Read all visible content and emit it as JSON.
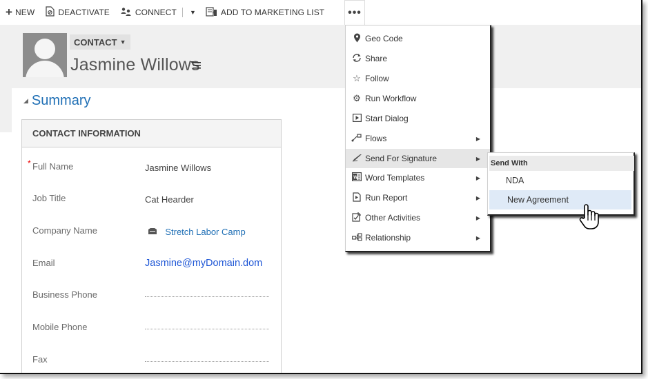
{
  "toolbar": {
    "new_label": "NEW",
    "deactivate_label": "DEACTIVATE",
    "connect_label": "CONNECT",
    "add_marketing_label": "ADD TO MARKETING LIST",
    "more_label": "•••"
  },
  "header": {
    "entity_label": "CONTACT",
    "record_name": "Jasmine Willows"
  },
  "summary": {
    "label": "Summary"
  },
  "contact_info": {
    "title": "CONTACT INFORMATION",
    "fields": [
      {
        "label": "Full Name",
        "value": "Jasmine Willows",
        "required": true
      },
      {
        "label": "Job Title",
        "value": "Cat Hearder"
      },
      {
        "label": "Company Name",
        "value": "Stretch Labor Camp"
      },
      {
        "label": "Email",
        "value": "Jasmine@myDomain.dom"
      },
      {
        "label": "Business Phone",
        "value": ""
      },
      {
        "label": "Mobile Phone",
        "value": ""
      },
      {
        "label": "Fax",
        "value": ""
      }
    ]
  },
  "more_menu": {
    "items": [
      {
        "label": "Geo Code",
        "icon": "map-pin-icon"
      },
      {
        "label": "Share",
        "icon": "share-icon"
      },
      {
        "label": "Follow",
        "icon": "star-icon"
      },
      {
        "label": "Run Workflow",
        "icon": "workflow-icon"
      },
      {
        "label": "Start Dialog",
        "icon": "dialog-icon"
      },
      {
        "label": "Flows",
        "icon": "flows-icon",
        "submenu": true
      },
      {
        "label": "Send For Signature",
        "icon": "signature-icon",
        "submenu": true,
        "active": true
      },
      {
        "label": "Word Templates",
        "icon": "word-icon",
        "submenu": true
      },
      {
        "label": "Run Report",
        "icon": "report-icon",
        "submenu": true
      },
      {
        "label": "Other Activities",
        "icon": "activities-icon",
        "submenu": true
      },
      {
        "label": "Relationship",
        "icon": "relationship-icon",
        "submenu": true
      }
    ]
  },
  "signature_menu": {
    "header": "Send With",
    "items": [
      {
        "label": "NDA"
      },
      {
        "label": "New Agreement",
        "hovered": true
      }
    ]
  }
}
